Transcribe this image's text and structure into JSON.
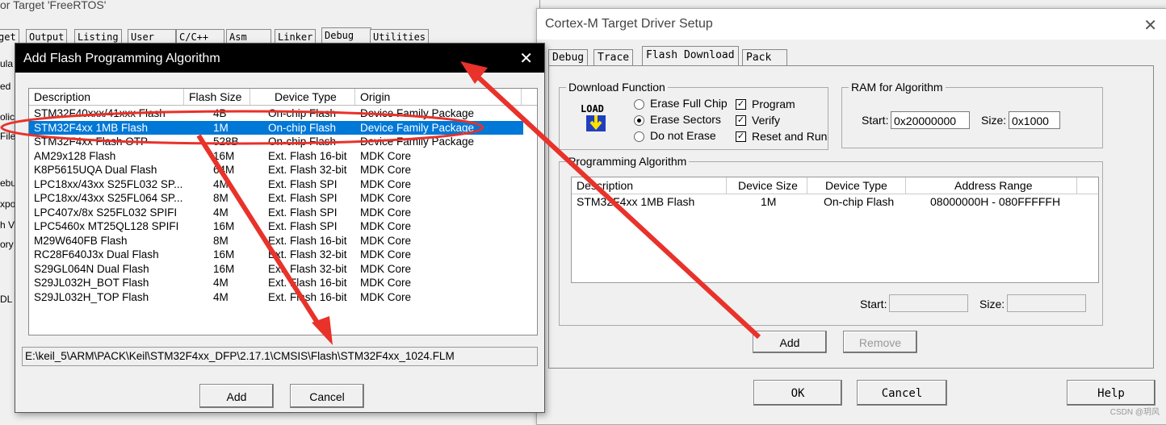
{
  "options_window": {
    "title": "or Target 'FreeRTOS'",
    "tabs": [
      "get",
      "Output",
      "Listing",
      "User",
      "C/C++",
      "Asm",
      "Linker",
      "Debug",
      "Utilities"
    ],
    "side_labels": [
      "ula",
      "ed",
      "olic",
      "File",
      "ebu",
      "xpo",
      "h V",
      "ory",
      "DL"
    ]
  },
  "driver_setup": {
    "title": "Cortex-M Target Driver Setup",
    "tabs": [
      "Debug",
      "Trace",
      "Flash Download",
      "Pack"
    ],
    "download_function": {
      "group_label": "Download Function",
      "icon_text": "LOAD",
      "radios": [
        "Erase Full Chip",
        "Erase Sectors",
        "Do not Erase"
      ],
      "selected_radio": "Erase Sectors",
      "checks": [
        {
          "label": "Program",
          "checked": true
        },
        {
          "label": "Verify",
          "checked": true
        },
        {
          "label": "Reset and Run",
          "checked": true
        }
      ]
    },
    "ram_for_algorithm": {
      "group_label": "RAM for Algorithm",
      "start_label": "Start:",
      "start_value": "0x20000000",
      "size_label": "Size:",
      "size_value": "0x1000"
    },
    "programming_algorithm": {
      "group_label": "Programming Algorithm",
      "columns": [
        "Description",
        "Device Size",
        "Device Type",
        "Address Range"
      ],
      "rows": [
        [
          "STM32F4xx 1MB Flash",
          "1M",
          "On-chip Flash",
          "08000000H - 080FFFFFH"
        ]
      ],
      "start_label": "Start:",
      "start_value": "",
      "size_label": "Size:",
      "size_value": ""
    },
    "buttons": {
      "add": "Add",
      "remove": "Remove",
      "ok": "OK",
      "cancel": "Cancel",
      "help": "Help"
    }
  },
  "add_dialog": {
    "title": "Add Flash Programming Algorithm",
    "columns": [
      "Description",
      "Flash Size",
      "Device Type",
      "Origin"
    ],
    "rows": [
      [
        "STM32F40xxx/41xxx Flash",
        "4B",
        "On-chip Flash",
        "Device Family Package"
      ],
      [
        "STM32F4xx 1MB Flash",
        "1M",
        "On-chip Flash",
        "Device Family Package"
      ],
      [
        "STM32F4xx Flash OTP",
        "528B",
        "On-chip Flash",
        "Device Family Package"
      ],
      [
        "AM29x128 Flash",
        "16M",
        "Ext. Flash 16-bit",
        "MDK Core"
      ],
      [
        "K8P5615UQA Dual Flash",
        "64M",
        "Ext. Flash 32-bit",
        "MDK Core"
      ],
      [
        "LPC18xx/43xx S25FL032 SP...",
        "4M",
        "Ext. Flash SPI",
        "MDK Core"
      ],
      [
        "LPC18xx/43xx S25FL064 SP...",
        "8M",
        "Ext. Flash SPI",
        "MDK Core"
      ],
      [
        "LPC407x/8x S25FL032 SPIFI",
        "4M",
        "Ext. Flash SPI",
        "MDK Core"
      ],
      [
        "LPC5460x MT25QL128 SPIFI",
        "16M",
        "Ext. Flash SPI",
        "MDK Core"
      ],
      [
        "M29W640FB Flash",
        "8M",
        "Ext. Flash 16-bit",
        "MDK Core"
      ],
      [
        "RC28F640J3x Dual Flash",
        "16M",
        "Ext. Flash 32-bit",
        "MDK Core"
      ],
      [
        "S29GL064N Dual Flash",
        "16M",
        "Ext. Flash 32-bit",
        "MDK Core"
      ],
      [
        "S29JL032H_BOT Flash",
        "4M",
        "Ext. Flash 16-bit",
        "MDK Core"
      ],
      [
        "S29JL032H_TOP Flash",
        "4M",
        "Ext. Flash 16-bit",
        "MDK Core"
      ]
    ],
    "selected_index": 1,
    "path": "E:\\keil_5\\ARM\\PACK\\Keil\\STM32F4xx_DFP\\2.17.1\\CMSIS\\Flash\\STM32F4xx_1024.FLM",
    "buttons": {
      "add": "Add",
      "cancel": "Cancel"
    }
  },
  "annotation_color": "#e8322a",
  "selection_color": "#0078d7",
  "watermark": "CSDN @玥风"
}
